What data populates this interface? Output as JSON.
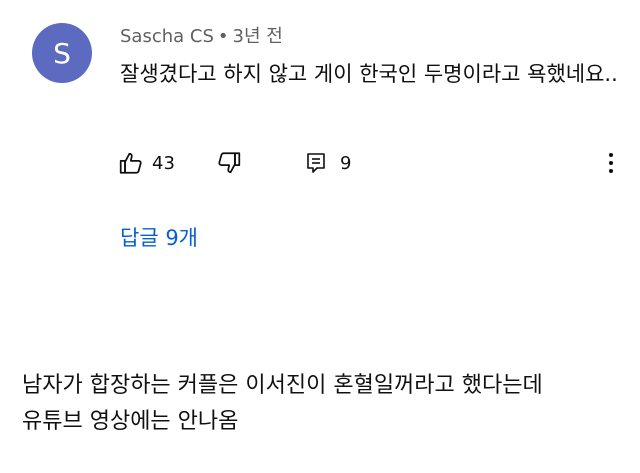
{
  "comment": {
    "avatar_letter": "S",
    "avatar_color": "#5c6bc0",
    "author": "Sascha CS",
    "separator": "•",
    "time": "3년 전",
    "text": "잘생겼다고 하지 않고 게이 한국인 두명이라고 욕했네요..",
    "like_count": "43",
    "reply_count": "9",
    "icons": {
      "like": "thumbs-up-icon",
      "dislike": "thumbs-down-icon",
      "reply": "comment-icon",
      "more": "more-vertical-icon"
    },
    "replies_link": "답글 9개"
  },
  "post": {
    "line1": "남자가 합장하는 커플은 이서진이 혼혈일꺼라고 했다는데",
    "line2": "유튜브 영상에는 안나옴"
  },
  "colors": {
    "link": "#065fd4",
    "meta": "#606060",
    "text": "#0f0f0f"
  }
}
